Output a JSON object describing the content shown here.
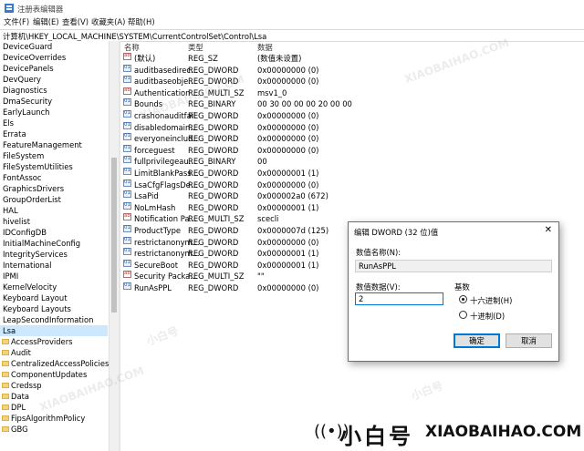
{
  "window": {
    "title": "注册表编辑器"
  },
  "menu": [
    "文件(F)",
    "编辑(E)",
    "查看(V)",
    "收藏夹(A)",
    "帮助(H)"
  ],
  "address": "计算机\\HKEY_LOCAL_MACHINE\\SYSTEM\\CurrentControlSet\\Control\\Lsa",
  "tree": {
    "items": [
      "DeviceGuard",
      "DeviceOverrides",
      "DevicePanels",
      "DevQuery",
      "Diagnostics",
      "DmaSecurity",
      "EarlyLaunch",
      "Els",
      "Errata",
      "FeatureManagement",
      "FileSystem",
      "FileSystemUtilities",
      "FontAssoc",
      "GraphicsDrivers",
      "GroupOrderList",
      "HAL",
      "hivelist",
      "IDConfigDB",
      "InitialMachineConfig",
      "IntegrityServices",
      "International",
      "IPMI",
      "KernelVelocity",
      "Keyboard Layout",
      "Keyboard Layouts",
      "LeapSecondInformation",
      "Lsa"
    ],
    "children": [
      "AccessProviders",
      "Audit",
      "CentralizedAccessPolicies",
      "ComponentUpdates",
      "Credssp",
      "Data",
      "DPL",
      "FipsAlgorithmPolicy",
      "GBG"
    ]
  },
  "columns": {
    "name": "名称",
    "type": "类型",
    "data": "数据"
  },
  "values": [
    {
      "name": "(默认)",
      "type": "REG_SZ",
      "data": "(数值未设置)",
      "icon": "str"
    },
    {
      "name": "auditbasedirec...",
      "type": "REG_DWORD",
      "data": "0x00000000 (0)",
      "icon": "bin"
    },
    {
      "name": "auditbaseobje...",
      "type": "REG_DWORD",
      "data": "0x00000000 (0)",
      "icon": "bin"
    },
    {
      "name": "Authentication ...",
      "type": "REG_MULTI_SZ",
      "data": "msv1_0",
      "icon": "str"
    },
    {
      "name": "Bounds",
      "type": "REG_BINARY",
      "data": "00 30 00 00 00 20 00 00",
      "icon": "bin"
    },
    {
      "name": "crashonauditfail",
      "type": "REG_DWORD",
      "data": "0x00000000 (0)",
      "icon": "bin"
    },
    {
      "name": "disabledomain...",
      "type": "REG_DWORD",
      "data": "0x00000000 (0)",
      "icon": "bin"
    },
    {
      "name": "everyoneinclud...",
      "type": "REG_DWORD",
      "data": "0x00000000 (0)",
      "icon": "bin"
    },
    {
      "name": "forceguest",
      "type": "REG_DWORD",
      "data": "0x00000000 (0)",
      "icon": "bin"
    },
    {
      "name": "fullprivilegeau...",
      "type": "REG_BINARY",
      "data": "00",
      "icon": "bin"
    },
    {
      "name": "LimitBlankPass...",
      "type": "REG_DWORD",
      "data": "0x00000001 (1)",
      "icon": "bin"
    },
    {
      "name": "LsaCfgFlagsDe...",
      "type": "REG_DWORD",
      "data": "0x00000000 (0)",
      "icon": "bin"
    },
    {
      "name": "LsaPid",
      "type": "REG_DWORD",
      "data": "0x000002a0 (672)",
      "icon": "bin"
    },
    {
      "name": "NoLmHash",
      "type": "REG_DWORD",
      "data": "0x00000001 (1)",
      "icon": "bin"
    },
    {
      "name": "Notification Pa...",
      "type": "REG_MULTI_SZ",
      "data": "scecli",
      "icon": "str"
    },
    {
      "name": "ProductType",
      "type": "REG_DWORD",
      "data": "0x0000007d (125)",
      "icon": "bin"
    },
    {
      "name": "restrictanonym...",
      "type": "REG_DWORD",
      "data": "0x00000000 (0)",
      "icon": "bin"
    },
    {
      "name": "restrictanonym...",
      "type": "REG_DWORD",
      "data": "0x00000001 (1)",
      "icon": "bin"
    },
    {
      "name": "SecureBoot",
      "type": "REG_DWORD",
      "data": "0x00000001 (1)",
      "icon": "bin"
    },
    {
      "name": "Security Packa...",
      "type": "REG_MULTI_SZ",
      "data": "\"\"",
      "icon": "str"
    },
    {
      "name": "RunAsPPL",
      "type": "REG_DWORD",
      "data": "0x00000000 (0)",
      "icon": "bin"
    }
  ],
  "dialog": {
    "title": "编辑 DWORD (32 位)值",
    "close": "✕",
    "name_label": "数值名称(N):",
    "name_value": "RunAsPPL",
    "data_label": "数值数据(V):",
    "data_value": "2",
    "base_label": "基数",
    "hex_label": "十六进制(H)",
    "dec_label": "十进制(D)",
    "selected_base": "hex",
    "ok": "确定",
    "cancel": "取消"
  },
  "watermark": {
    "cn": "小白号",
    "en": "XIAOBAIHAO.COM"
  }
}
